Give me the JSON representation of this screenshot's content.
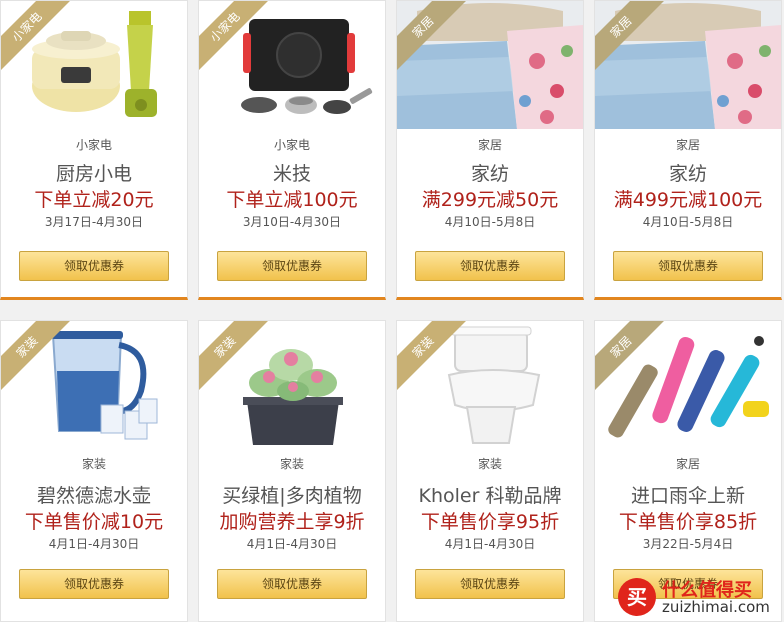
{
  "button_label": "领取优惠券",
  "cards": [
    {
      "ribbon": "小家电",
      "category": "小家电",
      "name": "厨房小电",
      "offer": "下单立减20元",
      "date": "3月17日-4月30日"
    },
    {
      "ribbon": "小家电",
      "category": "小家电",
      "name": "米技",
      "offer": "下单立减100元",
      "date": "3月10日-4月30日"
    },
    {
      "ribbon": "家居",
      "category": "家居",
      "name": "家纺",
      "offer": "满299元减50元",
      "date": "4月10日-5月8日"
    },
    {
      "ribbon": "家居",
      "category": "家居",
      "name": "家纺",
      "offer": "满499元减100元",
      "date": "4月10日-5月8日"
    },
    {
      "ribbon": "家装",
      "category": "家装",
      "name": "碧然德滤水壶",
      "offer": "下单售价减10元",
      "date": "4月1日-4月30日"
    },
    {
      "ribbon": "家装",
      "category": "家装",
      "name": "买绿植|多肉植物",
      "offer": "加购营养土享9折",
      "date": "4月1日-4月30日"
    },
    {
      "ribbon": "家装",
      "category": "家装",
      "name": "Kholer 科勒品牌",
      "offer": "下单售价享95折",
      "date": "4月1日-4月30日"
    },
    {
      "ribbon": "家居",
      "category": "家居",
      "name": "进口雨伞上新",
      "offer": "下单售价享85折",
      "date": "3月22日-5月4日"
    }
  ],
  "watermark": {
    "circle": "买",
    "title": "什么值得买",
    "url": "zuizhimai.com"
  }
}
